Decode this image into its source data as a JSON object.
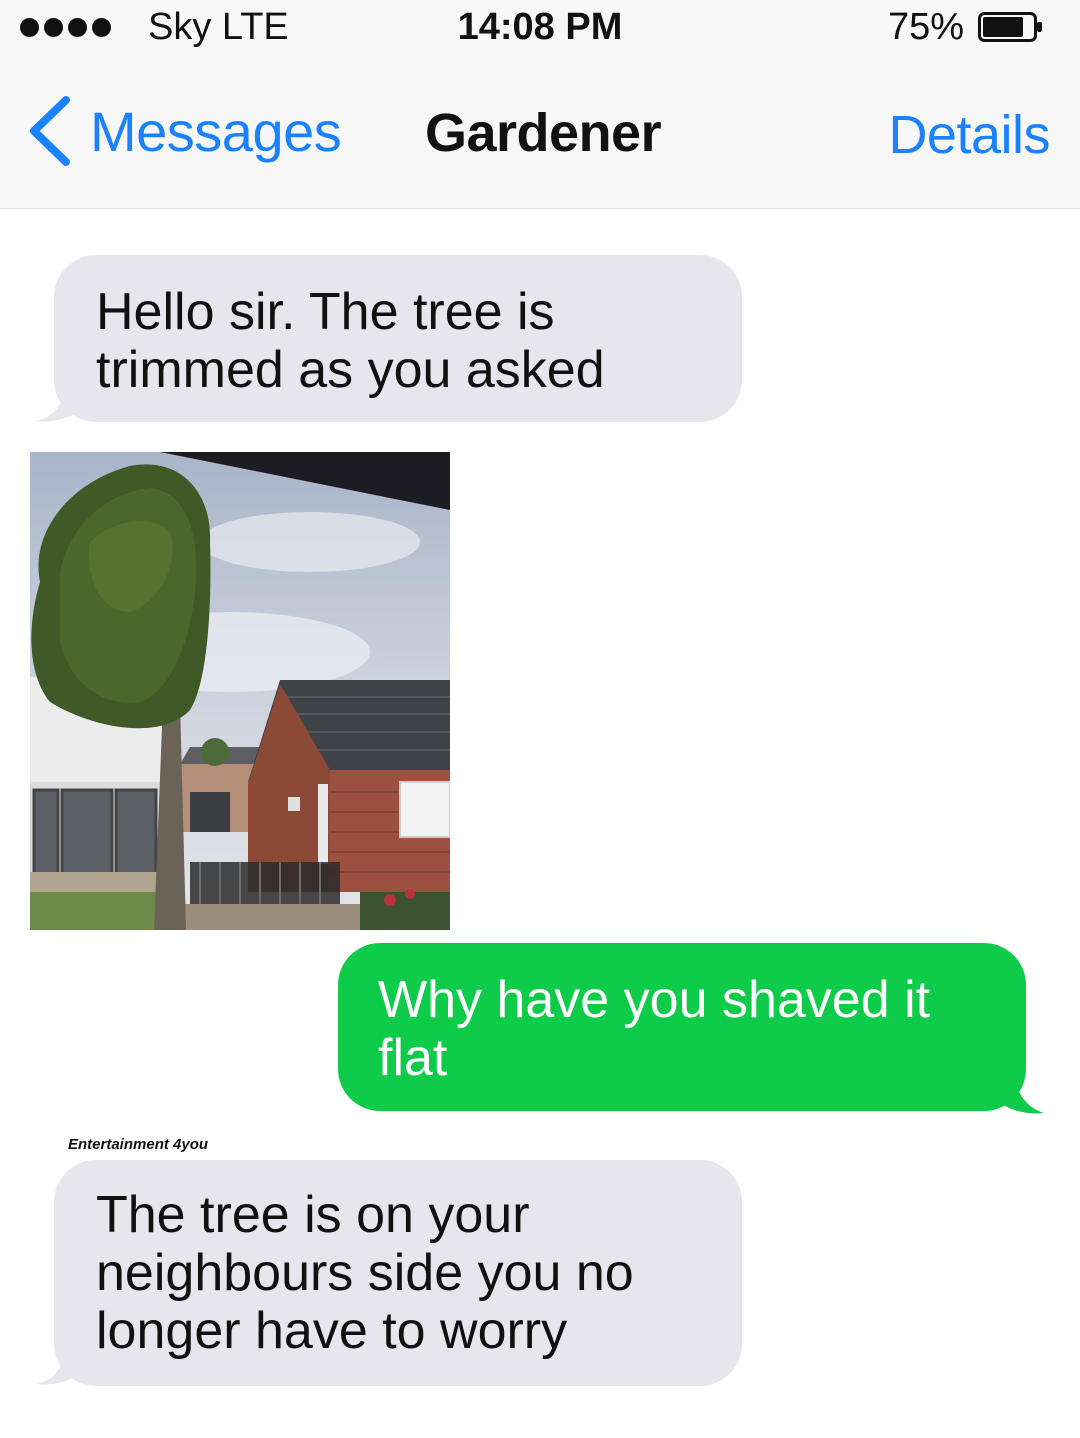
{
  "status_bar": {
    "carrier": "Sky  LTE",
    "time": "14:08 PM",
    "battery": "75%"
  },
  "nav": {
    "back_label": "Messages",
    "title": "Gardener",
    "details_label": "Details"
  },
  "messages": [
    {
      "direction": "incoming",
      "text": "Hello sir. The tree is trimmed as you asked"
    },
    {
      "direction": "incoming",
      "type": "image",
      "icon": "photo-of-trimmed-tree"
    },
    {
      "direction": "outgoing",
      "text": "Why have you shaved it flat"
    },
    {
      "direction": "incoming",
      "text": "The tree is on your neighbours side you no longer have to worry"
    }
  ],
  "watermark": "Entertainment 4you",
  "colors": {
    "accent": "#1a82ff",
    "incoming_bubble": "#e6e6ec",
    "outgoing_bubble": "#0ecc4a"
  }
}
